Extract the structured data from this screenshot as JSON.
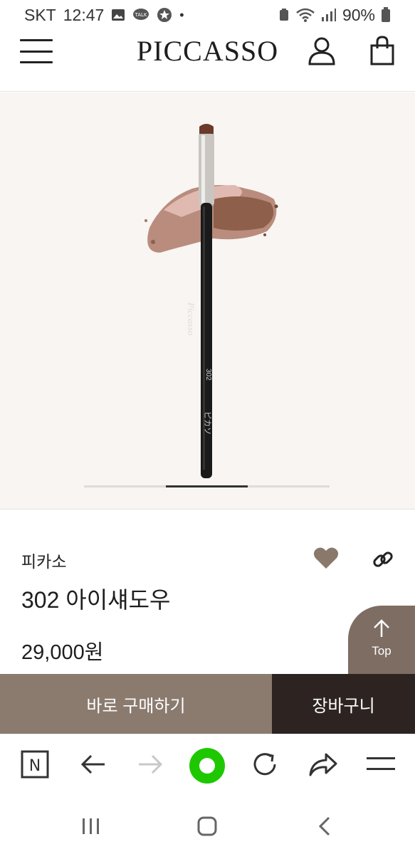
{
  "status_bar": {
    "carrier": "SKT",
    "time": "12:47",
    "dot": "•",
    "battery": "90%"
  },
  "header": {
    "logo": "PICCASSO",
    "icons": [
      "menu-icon",
      "user-icon",
      "shopping-bag-icon"
    ]
  },
  "product_image": {
    "brush_text_brand": "Piccasso",
    "brush_text_number": "302",
    "brush_text_jp": "ピカソ",
    "gallery_progress": 0.5
  },
  "product": {
    "brand": "피카소",
    "title": "302 아이섀도우",
    "price": "29,000원"
  },
  "top_button": {
    "label": "Top"
  },
  "buy_bar": {
    "buy_now": "바로 구매하기",
    "add_to_cart": "장바구니"
  },
  "colors": {
    "buy_now_bg": "#8b7b6f",
    "add_cart_bg": "#2d2421",
    "top_button_bg": "#7e6d63",
    "heart": "#8a786b",
    "naver_green": "#1ec800"
  },
  "browser_bar": {
    "icons": [
      "naver-n-icon",
      "back-arrow-icon",
      "forward-arrow-icon",
      "green-dot-icon",
      "refresh-icon",
      "share-arrow-icon",
      "menu-icon"
    ],
    "n_letter": "N"
  },
  "nav_bar": {
    "icons": [
      "recent-apps-icon",
      "home-icon",
      "back-icon"
    ]
  }
}
